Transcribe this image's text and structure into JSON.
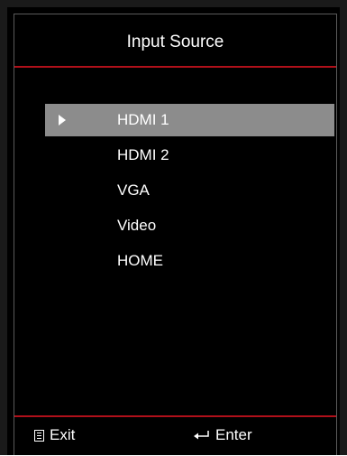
{
  "menu": {
    "title": "Input Source",
    "items": [
      {
        "label": "HDMI 1",
        "selected": true
      },
      {
        "label": "HDMI 2",
        "selected": false
      },
      {
        "label": "VGA",
        "selected": false
      },
      {
        "label": "Video",
        "selected": false
      },
      {
        "label": "HOME",
        "selected": false
      }
    ]
  },
  "footer": {
    "exit_icon": "menu-icon",
    "exit_label": "Exit",
    "enter_icon": "enter-icon",
    "enter_label": "Enter"
  },
  "colors": {
    "background": "#000000",
    "accent_rule": "#b0101a",
    "selection": "#8c8c8c",
    "text": "#ffffff"
  }
}
